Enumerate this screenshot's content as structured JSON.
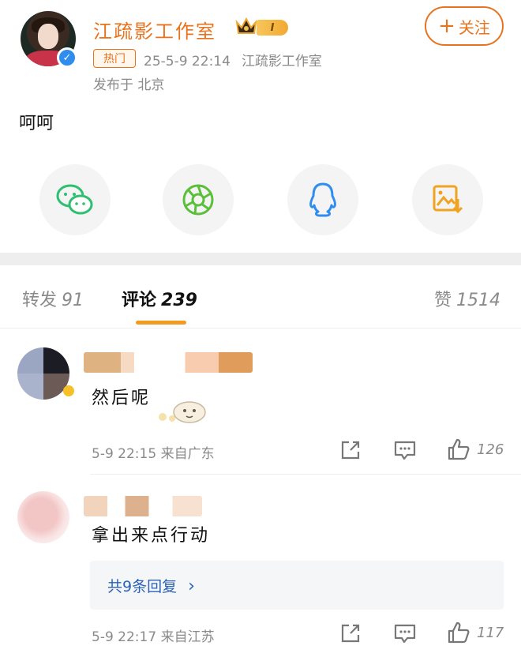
{
  "post": {
    "author": "江疏影工作室",
    "level_badge": "I",
    "hot_tag": "热门",
    "datetime": "25-5-9 22:14",
    "source": "江疏影工作室",
    "publish_location": "发布于 北京",
    "follow_label": "关注",
    "follow_plus": "+",
    "text": "呵呵",
    "share_icons": [
      "wechat-icon",
      "moments-icon",
      "qq-icon",
      "save-image-icon"
    ],
    "colors": {
      "accent": "#e8731e",
      "wechat": "#2fbf71",
      "moments": "#5bbf3a",
      "qq": "#2f8df0",
      "save": "#f0a320",
      "link": "#2b62b5"
    }
  },
  "tabs": [
    {
      "label": "转发",
      "count": "91"
    },
    {
      "label": "评论",
      "count": "239"
    },
    {
      "label": "赞",
      "count": "1514"
    }
  ],
  "comments": [
    {
      "text": "然后呢",
      "time": "5-9 22:15",
      "location": "来自广东",
      "likes": "126"
    },
    {
      "text": "拿出来点行动",
      "replies_label": "共9条回复",
      "replies_chevron": "›",
      "time": "5-9 22:17",
      "location": "来自江苏",
      "likes": "117"
    }
  ]
}
